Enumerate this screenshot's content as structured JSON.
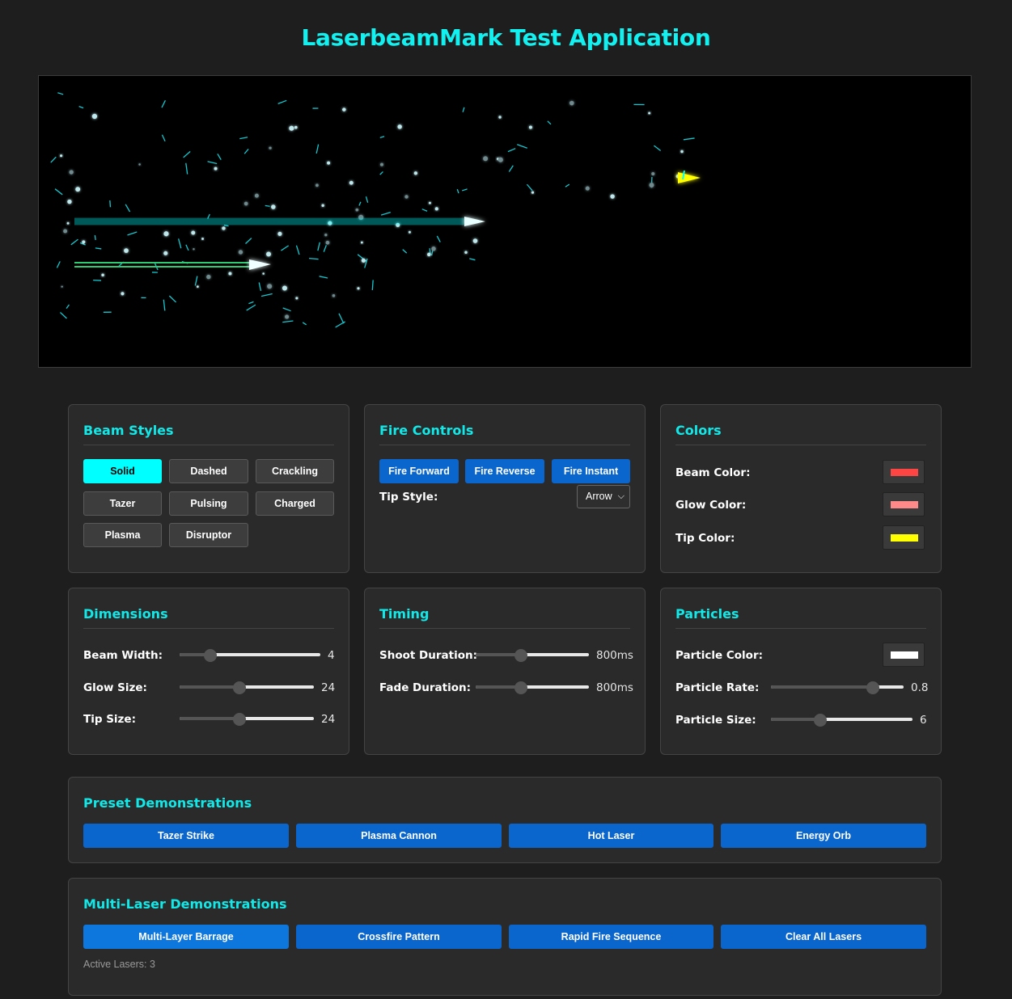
{
  "app": {
    "title": "LaserbeamMark Test Application"
  },
  "colors": {
    "accent": "#12e8e8",
    "beam_red": "#ff4444",
    "beam_cyan": "#66ffff",
    "beam_green": "#2ecc71",
    "tip_yellow": "#ffff00"
  },
  "beam_styles": {
    "title": "Beam Styles",
    "selected": "Solid",
    "items": [
      "Solid",
      "Dashed",
      "Crackling",
      "Tazer",
      "Pulsing",
      "Charged",
      "Plasma",
      "Disruptor"
    ]
  },
  "fire_controls": {
    "title": "Fire Controls",
    "buttons": [
      "Fire Forward",
      "Fire Reverse",
      "Fire Instant"
    ],
    "tip_style_label": "Tip Style:",
    "tip_style_value": "Arrow"
  },
  "colors_panel": {
    "title": "Colors",
    "beam_label": "Beam Color:",
    "beam_value": "#ff4444",
    "glow_label": "Glow Color:",
    "glow_value": "#ff8888",
    "tip_label": "Tip Color:",
    "tip_value": "#ffff00"
  },
  "dimensions": {
    "title": "Dimensions",
    "beam_width_label": "Beam Width:",
    "beam_width_value": "4",
    "beam_width_fraction": 0.21,
    "glow_size_label": "Glow Size:",
    "glow_size_value": "24",
    "glow_size_fraction": 0.44,
    "tip_size_label": "Tip Size:",
    "tip_size_value": "24",
    "tip_size_fraction": 0.44
  },
  "timing": {
    "title": "Timing",
    "shoot_label": "Shoot Duration:",
    "shoot_value": "800ms",
    "shoot_fraction": 0.39,
    "fade_label": "Fade Duration:",
    "fade_value": "800ms",
    "fade_fraction": 0.39
  },
  "particles": {
    "title": "Particles",
    "color_label": "Particle Color:",
    "color_value": "#ffffff",
    "rate_label": "Particle Rate:",
    "rate_value": "0.8",
    "rate_fraction": 0.76,
    "size_label": "Particle Size:",
    "size_value": "6",
    "size_fraction": 0.34
  },
  "presets": {
    "title": "Preset Demonstrations",
    "buttons": [
      "Tazer Strike",
      "Plasma Cannon",
      "Hot Laser",
      "Energy Orb"
    ]
  },
  "multi": {
    "title": "Multi-Laser Demonstrations",
    "buttons": [
      "Multi-Layer Barrage",
      "Crossfire Pattern",
      "Rapid Fire Sequence",
      "Clear All Lasers"
    ],
    "active_lasers": "Active Lasers: 3"
  }
}
